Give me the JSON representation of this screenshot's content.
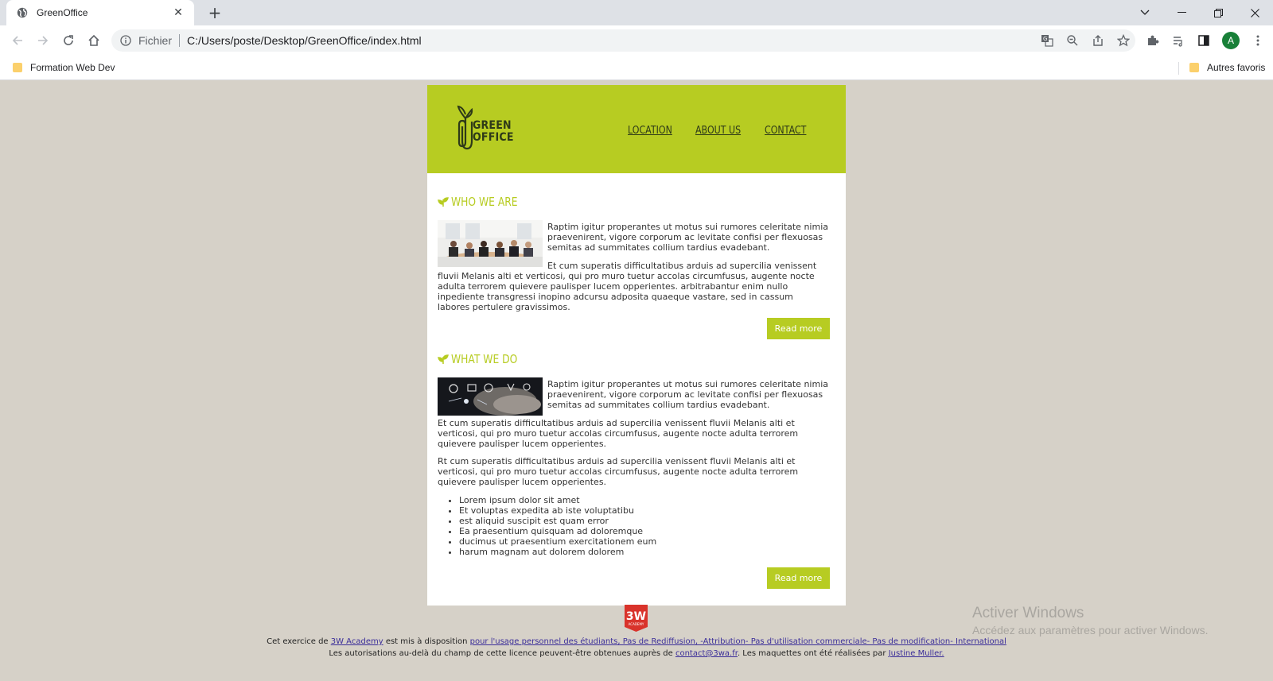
{
  "browser": {
    "tab_title": "GreenOffice",
    "omnibox_scheme": "Fichier",
    "omnibox_url": "C:/Users/poste/Desktop/GreenOffice/index.html",
    "avatar_initial": "A",
    "bookmarks": [
      {
        "label": "Formation Web Dev"
      }
    ],
    "other_bookmarks": "Autres favoris"
  },
  "site": {
    "logo_line1": "GREEN",
    "logo_line2": "OFFICE",
    "nav": [
      "LOCATION",
      "ABOUT US",
      "CONTACT"
    ],
    "accent_color": "#b7cc22",
    "sections": [
      {
        "title": "WHO WE ARE",
        "intro": "Raptim igitur properantes ut motus sui rumores celeritate nimia praevenirent, vigore corporum ac levitate confisi per flexuosas semitas ad summitates collium tardius evadebant.",
        "body": "Et cum superatis difficultatibus arduis ad supercilia venissent fluvii Melanis alti et verticosi, qui pro muro tuetur accolas circumfusus, augente nocte adulta terrorem quievere paulisper lucem opperientes. arbitrabantur enim nullo inpediente transgressi inopino adcursu adposita quaeque vastare, sed in cassum labores pertulere gravissimos.",
        "button": "Read more"
      },
      {
        "title": "WHAT WE DO",
        "intro": "Raptim igitur properantes ut motus sui rumores celeritate nimia praevenirent, vigore corporum ac levitate confisi per flexuosas semitas ad summitates collium tardius evadebant.",
        "body1": "Et cum superatis difficultatibus arduis ad supercilia venissent fluvii Melanis alti et verticosi, qui pro muro tuetur accolas circumfusus, augente nocte adulta terrorem quievere paulisper lucem opperientes.",
        "body2": "Rt cum superatis difficultatibus arduis ad supercilia venissent fluvii Melanis alti et verticosi, qui pro muro tuetur accolas circumfusus, augente nocte adulta terrorem quievere paulisper lucem opperientes.",
        "list": [
          "Lorem ipsum dolor sit amet",
          "Et voluptas expedita ab iste voluptatibu",
          "est aliquid suscipit est quam error",
          "Ea praesentium quisquam ad doloremque",
          "ducimus ut praesentium exercitationem eum",
          "harum magnam aut dolorem dolorem"
        ],
        "button": "Read more"
      }
    ]
  },
  "footer": {
    "logo_text": "3W",
    "logo_sub": "ACADEMY",
    "line1_prefix": "Cet exercice de ",
    "line1_link1": "3W Academy",
    "line1_mid": " est mis à disposition ",
    "line1_link2": "pour l'usage personnel des étudiants, Pas de Rediffusion, -Attribution- Pas d'utilisation commerciale- Pas de modification- International",
    "line2_prefix": "Les autorisations au-delà du champ de cette licence peuvent-être obtenues auprès de ",
    "line2_link1": "contact@3wa.fr",
    "line2_mid": ". Les maquettes ont été réalisées par ",
    "line2_link2": "Justine Muller."
  },
  "watermark": {
    "title": "Activer Windows",
    "subtitle": "Accédez aux paramètres pour activer Windows."
  }
}
